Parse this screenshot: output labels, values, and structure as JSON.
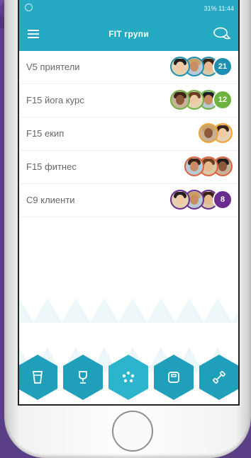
{
  "status": {
    "text": "31% 11:44"
  },
  "appbar": {
    "title": "FIT групи"
  },
  "groups": [
    {
      "name": "V5 приятели",
      "count": "21",
      "color": "#1e8fb0",
      "avatars": 3,
      "ring": "#1e8fb0"
    },
    {
      "name": "F15 йога курс",
      "count": "12",
      "color": "#6cb33f",
      "avatars": 3,
      "ring": "#6cb33f"
    },
    {
      "name": "F15 екип",
      "count": "",
      "color": "#f0a030",
      "avatars": 2,
      "ring": "#f0a030"
    },
    {
      "name": "F15 фитнес",
      "count": "",
      "color": "#e0603a",
      "avatars": 3,
      "ring": "#e0603a"
    },
    {
      "name": "C9 клиенти",
      "count": "8",
      "color": "#6a2c8e",
      "avatars": 3,
      "ring": "#6a2c8e"
    }
  ],
  "nav": [
    {
      "name": "drink-icon"
    },
    {
      "name": "trophy-icon"
    },
    {
      "name": "groups-icon"
    },
    {
      "name": "scale-icon"
    },
    {
      "name": "dumbbell-icon"
    }
  ]
}
